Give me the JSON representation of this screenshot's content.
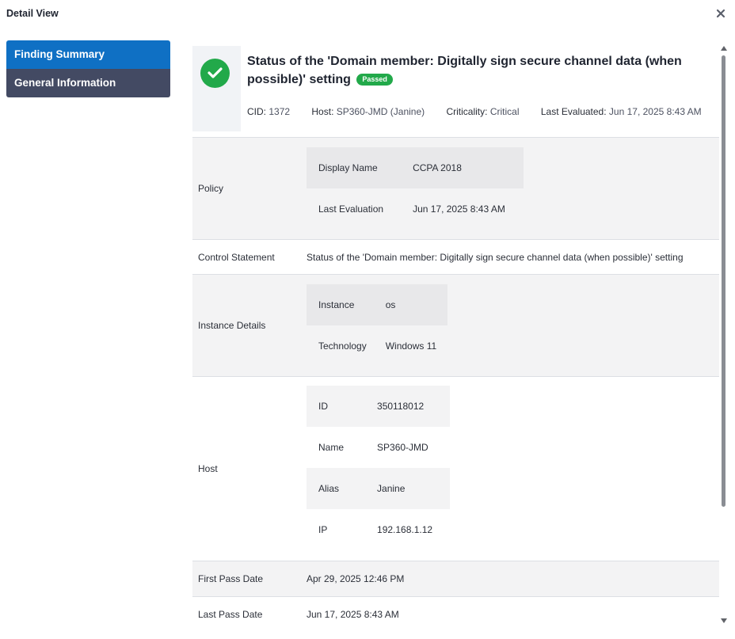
{
  "dialog": {
    "title": "Detail View"
  },
  "sidebar": {
    "items": [
      {
        "label": "Finding Summary",
        "active": true
      },
      {
        "label": "General Information",
        "active": false
      }
    ]
  },
  "finding": {
    "title": "Status of the 'Domain member: Digitally sign secure channel data (when possible)' setting",
    "status_badge": "Passed",
    "status_icon": "check-circle-icon",
    "meta": {
      "cid_label": "CID:",
      "cid_value": "1372",
      "host_label": "Host:",
      "host_value": "SP360-JMD (Janine)",
      "criticality_label": "Criticality:",
      "criticality_value": "Critical",
      "last_eval_label": "Last Evaluated:",
      "last_eval_value": "Jun 17, 2025 8:43 AM"
    }
  },
  "details": {
    "policy": {
      "label": "Policy",
      "display_name_key": "Display Name",
      "display_name_value": "CCPA 2018",
      "last_eval_key": "Last Evaluation",
      "last_eval_value": "Jun 17, 2025 8:43 AM"
    },
    "control_statement": {
      "label": "Control Statement",
      "value": "Status of the 'Domain member: Digitally sign secure channel data (when possible)' setting"
    },
    "instance_details": {
      "label": "Instance Details",
      "instance_key": "Instance",
      "instance_value": "os",
      "technology_key": "Technology",
      "technology_value": "Windows 11"
    },
    "host": {
      "label": "Host",
      "id_key": "ID",
      "id_value": "350118012",
      "name_key": "Name",
      "name_value": "SP360-JMD",
      "alias_key": "Alias",
      "alias_value": "Janine",
      "ip_key": "IP",
      "ip_value": "192.168.1.12"
    },
    "first_pass": {
      "label": "First Pass Date",
      "value": "Apr 29, 2025 12:46 PM"
    },
    "last_pass": {
      "label": "Last Pass Date",
      "value": "Jun 17, 2025 8:43 AM"
    }
  },
  "colors": {
    "active_nav": "#0f70c4",
    "inactive_nav": "#434a63",
    "passed_green": "#22a94a"
  }
}
